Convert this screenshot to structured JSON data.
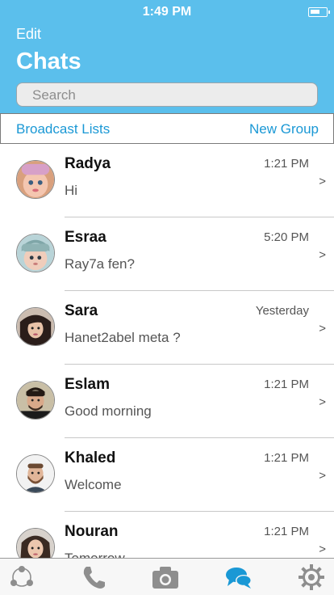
{
  "status_bar": {
    "time": "1:49 PM"
  },
  "header": {
    "edit_label": "Edit",
    "title": "Chats",
    "search_placeholder": "Search"
  },
  "links": {
    "broadcast_label": "Broadcast Lists",
    "new_group_label": "New Group"
  },
  "chats": [
    {
      "name": "Radya",
      "time": "1:21 PM",
      "message": "Hi"
    },
    {
      "name": "Esraa",
      "time": "5:20 PM",
      "message": "Ray7a fen?"
    },
    {
      "name": "Sara",
      "time": "Yesterday",
      "message": "Hanet2abel meta ?"
    },
    {
      "name": "Eslam",
      "time": "1:21 PM",
      "message": "Good morning"
    },
    {
      "name": "Khaled",
      "time": "1:21 PM",
      "message": "Welcome"
    },
    {
      "name": "Nouran",
      "time": "1:21 PM",
      "message": "Tomorrow"
    }
  ],
  "chevron": ">",
  "tabs": [
    {
      "icon": "contacts-icon",
      "active": false
    },
    {
      "icon": "phone-icon",
      "active": false
    },
    {
      "icon": "camera-icon",
      "active": false
    },
    {
      "icon": "chats-icon",
      "active": true
    },
    {
      "icon": "settings-icon",
      "active": false
    }
  ],
  "colors": {
    "header": "#5bbfec",
    "accent": "#1a98d5",
    "tab_inactive": "#8e8e8e"
  }
}
